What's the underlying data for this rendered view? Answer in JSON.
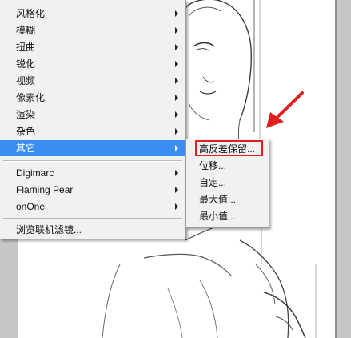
{
  "menu": {
    "items": [
      {
        "label": "风格化",
        "has_submenu": true
      },
      {
        "label": "模糊",
        "has_submenu": true
      },
      {
        "label": "扭曲",
        "has_submenu": true
      },
      {
        "label": "锐化",
        "has_submenu": true
      },
      {
        "label": "视频",
        "has_submenu": true
      },
      {
        "label": "像素化",
        "has_submenu": true
      },
      {
        "label": "渲染",
        "has_submenu": true
      },
      {
        "label": "杂色",
        "has_submenu": true
      },
      {
        "label": "其它",
        "has_submenu": true,
        "active": true
      }
    ],
    "plugins": [
      {
        "label": "Digimarc",
        "has_submenu": true
      },
      {
        "label": "Flaming Pear",
        "has_submenu": true
      },
      {
        "label": "onOne",
        "has_submenu": true
      }
    ],
    "browse_label": "浏览联机滤镜..."
  },
  "submenu": {
    "items": [
      {
        "label": "高反差保留...",
        "highlighted": true
      },
      {
        "label": "位移..."
      },
      {
        "label": "自定..."
      },
      {
        "label": "最大值..."
      },
      {
        "label": "最小值..."
      }
    ]
  },
  "colors": {
    "active_bg": "#3a8ef3",
    "highlight_box": "#e02020",
    "arrow": "#e02020"
  }
}
